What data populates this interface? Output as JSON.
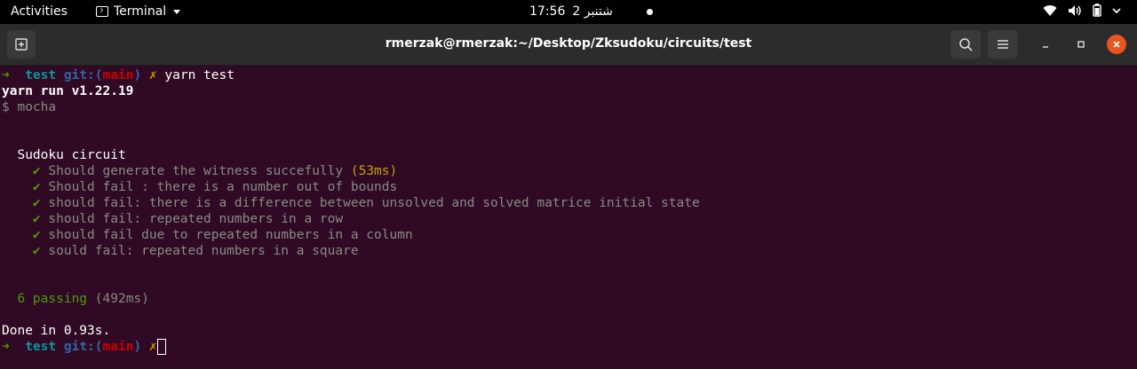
{
  "system_bar": {
    "activities": "Activities",
    "app_name": "Terminal",
    "time": "17:56",
    "date": "2 شتنبر"
  },
  "window": {
    "title": "rmerzak@rmerzak:~/Desktop/Zksudoku/circuits/test"
  },
  "terminal": {
    "prompt_arrow": "➜",
    "prompt_dir": "test",
    "git_label": "git:(",
    "git_branch": "main",
    "git_close": ")",
    "dirty_mark": "✗",
    "command": "yarn test",
    "yarn_version": "yarn run v1.22.19",
    "run_cmd": "$ mocha",
    "suite": "Sudoku circuit",
    "check": "✔",
    "tests": [
      {
        "title": "Should generate the witness succefully",
        "duration": "(53ms)"
      },
      {
        "title": "Should fail : there is a number out of bounds",
        "duration": ""
      },
      {
        "title": "should fail: there is a difference between unsolved and solved matrice initial state",
        "duration": ""
      },
      {
        "title": "should fail: repeated numbers in a row",
        "duration": ""
      },
      {
        "title": "should fail due to repeated numbers in a column",
        "duration": ""
      },
      {
        "title": "sould fail: repeated numbers in a square",
        "duration": ""
      }
    ],
    "passing": "6 passing",
    "passing_time": "(492ms)",
    "done": "Done in 0.93s."
  }
}
